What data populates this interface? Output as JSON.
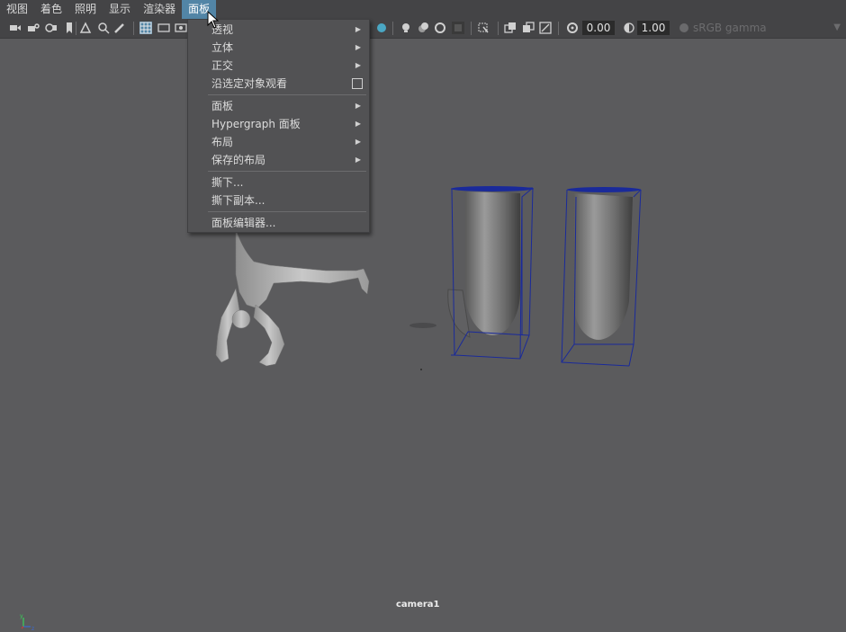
{
  "menubar": {
    "items": [
      {
        "label": "视图"
      },
      {
        "label": "着色"
      },
      {
        "label": "照明"
      },
      {
        "label": "显示"
      },
      {
        "label": "渲染器"
      },
      {
        "label": "面板"
      }
    ]
  },
  "toolbar": {
    "field_a": "0.00",
    "field_b": "1.00",
    "color_space": "sRGB gamma"
  },
  "panel_menu": {
    "items": [
      {
        "label": "透视",
        "submenu": true
      },
      {
        "label": "立体",
        "submenu": true
      },
      {
        "label": "正交",
        "submenu": true
      },
      {
        "label": "沿选定对象观看",
        "checkbox": true
      },
      {
        "label": "面板",
        "submenu": true
      },
      {
        "label": "Hypergraph 面板",
        "submenu": true
      },
      {
        "label": "布局",
        "submenu": true
      },
      {
        "label": "保存的布局",
        "submenu": true
      },
      {
        "label": "撕下..."
      },
      {
        "label": "撕下副本..."
      },
      {
        "label": "面板编辑器..."
      }
    ]
  },
  "viewport": {
    "camera_label": "camera1",
    "axis_y": "y",
    "axis_z": "z"
  },
  "colors": {
    "viewport_bg": "#5b5b5d",
    "menu_active": "#5285a6",
    "selection_box": "#1a2a9a"
  }
}
